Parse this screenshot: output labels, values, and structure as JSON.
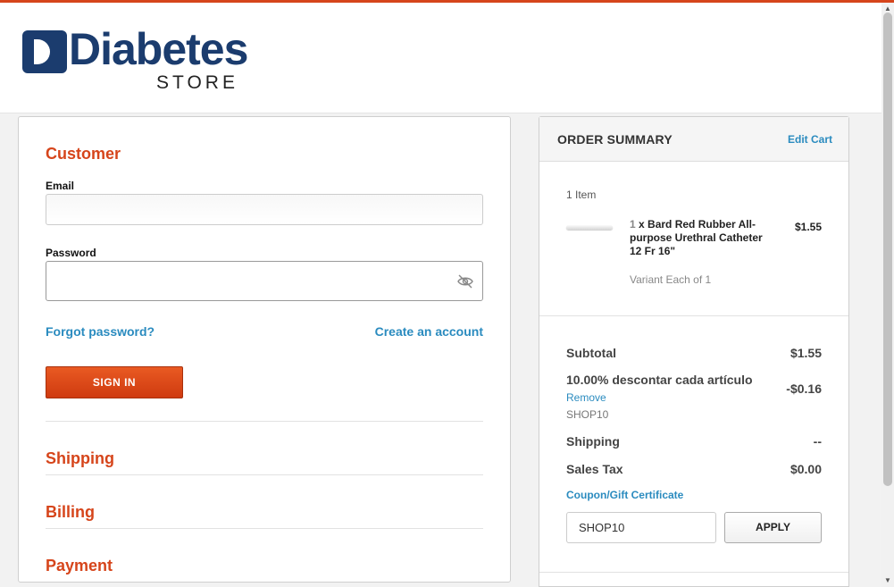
{
  "brand": {
    "logo_word": "Diabetes",
    "logo_sub": "STORE",
    "accent_color": "#d6451b",
    "navy_color": "#1b3c6e",
    "link_color": "#2a8bbf"
  },
  "checkout": {
    "customer_title": "Customer",
    "email_label": "Email",
    "email_value": "",
    "password_label": "Password",
    "password_value": "",
    "password_toggle_icon": "eye-slash-icon",
    "forgot_password": "Forgot password?",
    "create_account": "Create an account",
    "sign_in": "SIGN IN",
    "shipping_title": "Shipping",
    "billing_title": "Billing",
    "payment_title": "Payment"
  },
  "summary": {
    "title": "ORDER SUMMARY",
    "edit_cart": "Edit Cart",
    "item_count": "1 Item",
    "item": {
      "qty": "1",
      "name": "x Bard Red Rubber All-purpose Urethral Catheter 12 Fr 16\"",
      "price": "$1.55",
      "variant": "Variant Each of 1"
    },
    "subtotal_label": "Subtotal",
    "subtotal_value": "$1.55",
    "discount_label": "10.00% descontar cada artículo",
    "discount_value": "-$0.16",
    "remove": "Remove",
    "discount_code": "SHOP10",
    "shipping_label": "Shipping",
    "shipping_value": "--",
    "tax_label": "Sales Tax",
    "tax_value": "$0.00",
    "coupon_link": "Coupon/Gift Certificate",
    "coupon_value": "SHOP10",
    "apply": "APPLY"
  }
}
